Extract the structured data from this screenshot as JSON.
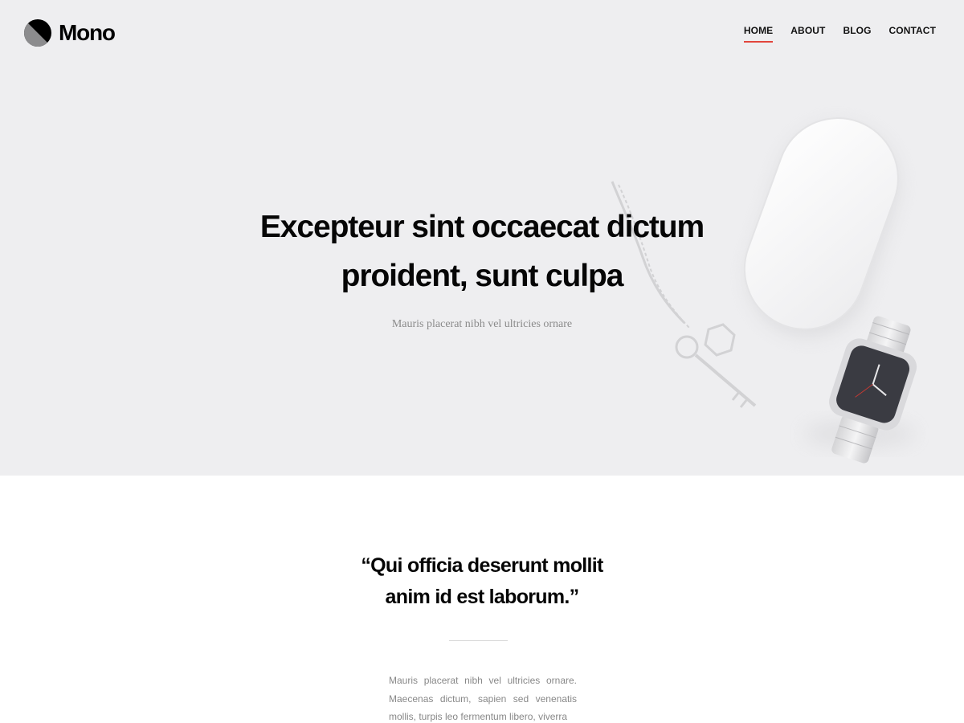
{
  "brand": {
    "name": "Mono",
    "icon": "half-circle-logo-icon"
  },
  "nav": {
    "items": [
      {
        "label": "HOME",
        "active": true
      },
      {
        "label": "ABOUT",
        "active": false
      },
      {
        "label": "BLOG",
        "active": false
      },
      {
        "label": "CONTACT",
        "active": false
      }
    ]
  },
  "hero": {
    "title": "Excepteur sint occaecat dictum proident, sunt culpa",
    "subtitle": "Mauris placerat nibh vel ultricies ornare",
    "background_items": [
      "computer-mouse-image",
      "keychain-image",
      "wristwatch-image"
    ]
  },
  "quote": {
    "lines": [
      "“Qui officia deserunt mollit",
      "anim id est laborum.”"
    ]
  },
  "body_text": "Mauris placerat nibh vel ultricies ornare. Maecenas dictum, sapien sed venenatis mollis, turpis leo fermentum libero, viverra",
  "colors": {
    "hero_background": "#eeeef0",
    "accent": "#e2453c",
    "text_dark": "#060606",
    "text_muted": "#888888"
  }
}
